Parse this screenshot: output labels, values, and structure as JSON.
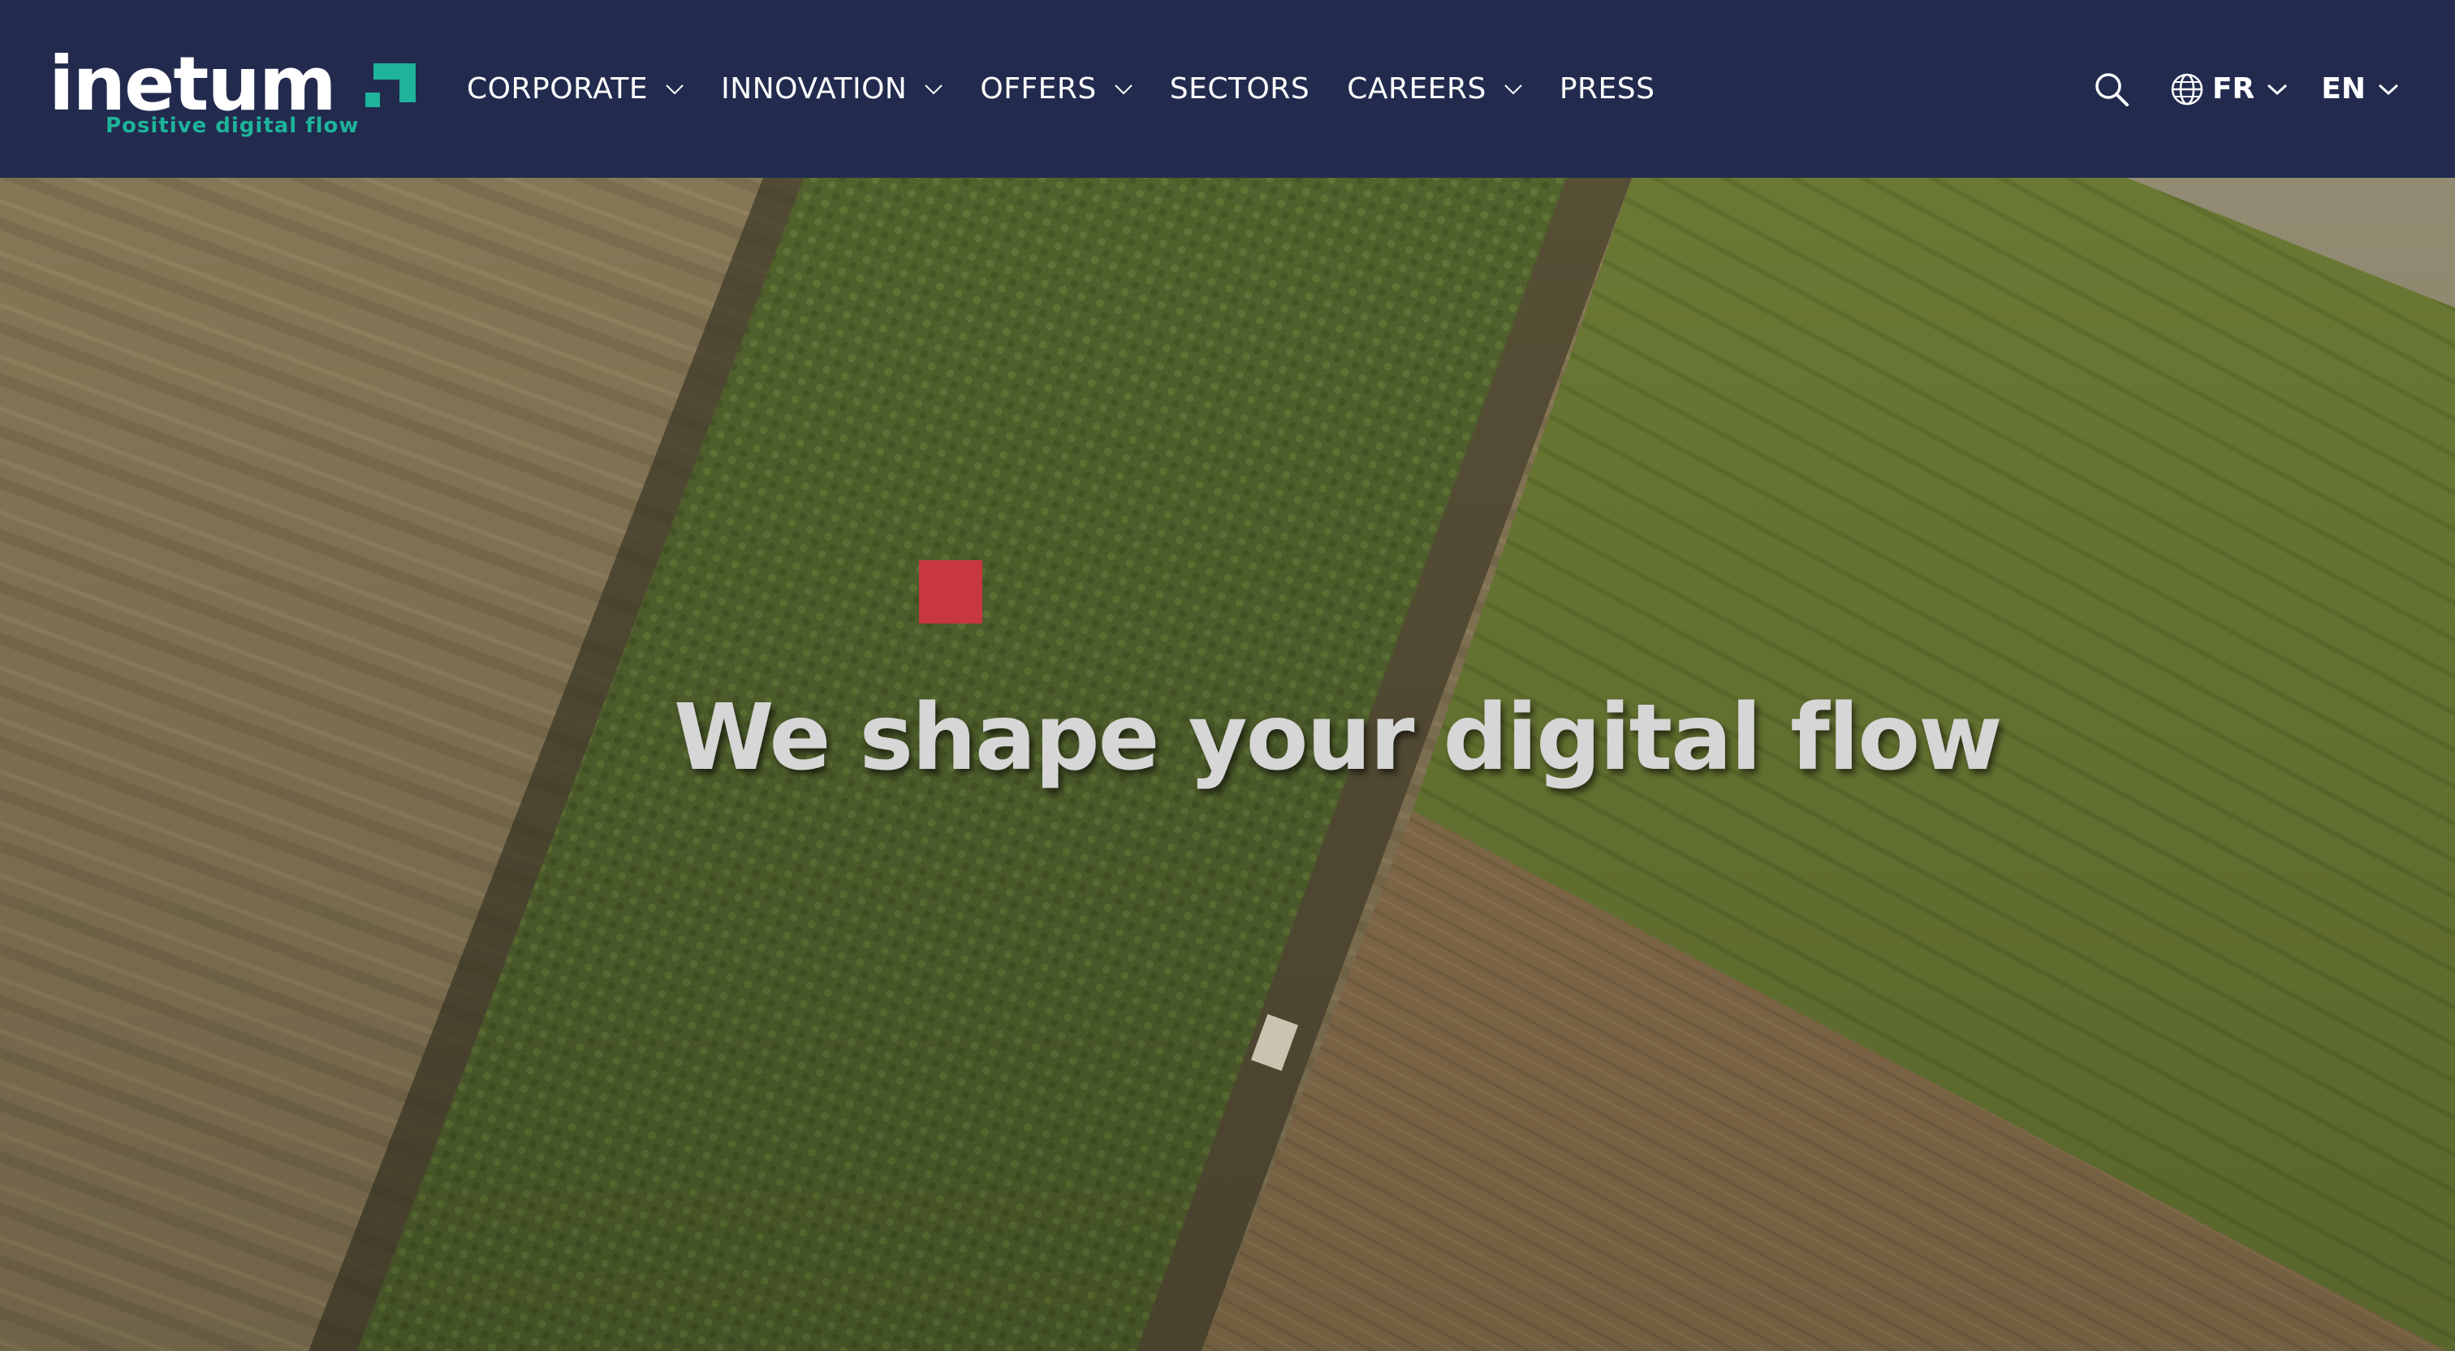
{
  "brand": {
    "name": "inetum",
    "tagline": "Positive digital flow",
    "colors": {
      "navy": "#222b4e",
      "teal": "#1eb39a",
      "accent_red": "#c8373f"
    }
  },
  "nav": {
    "items": [
      {
        "label": "CORPORATE",
        "dropdown": true
      },
      {
        "label": "INNOVATION",
        "dropdown": true
      },
      {
        "label": "OFFERS",
        "dropdown": true
      },
      {
        "label": "SECTORS",
        "dropdown": false
      },
      {
        "label": "CAREERS",
        "dropdown": true
      },
      {
        "label": "PRESS",
        "dropdown": false
      }
    ]
  },
  "tools": {
    "search_icon": "search-icon",
    "region": {
      "label": "FR",
      "icon": "globe-icon"
    },
    "language": {
      "label": "EN"
    }
  },
  "hero": {
    "title": "We shape your digital flow"
  }
}
